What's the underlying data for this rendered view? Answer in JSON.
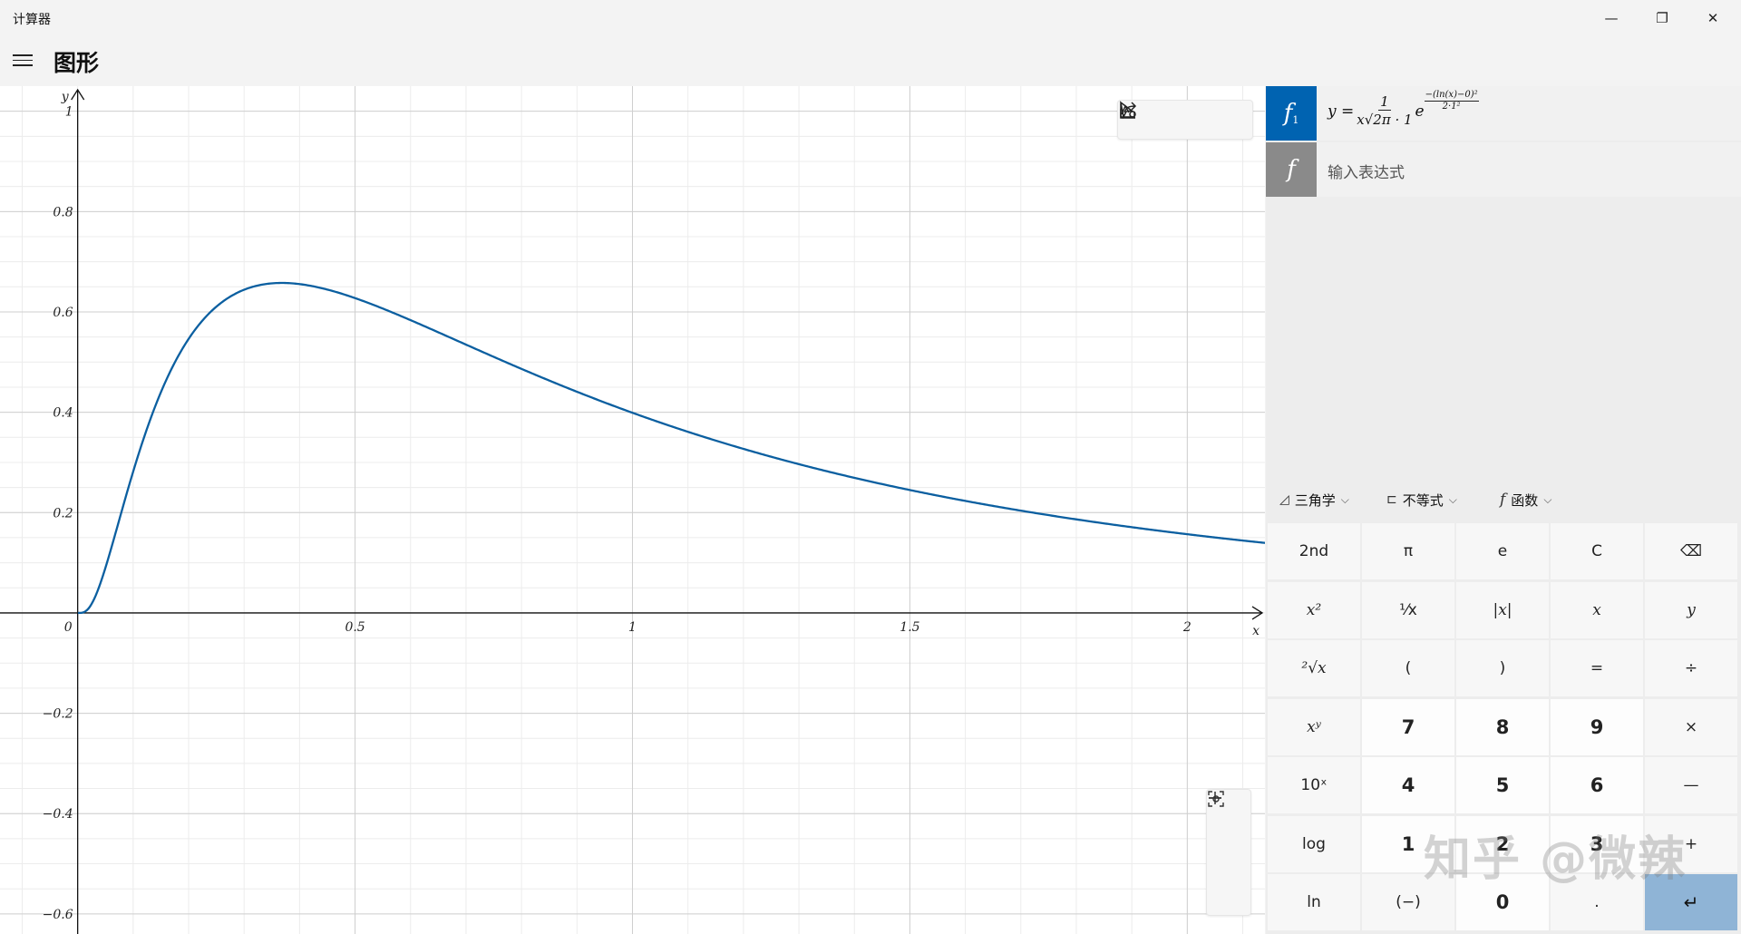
{
  "window": {
    "title": "计算器",
    "controls": {
      "minimize": "—",
      "restore": "❐",
      "close": "✕"
    }
  },
  "header": {
    "mode_title": "图形"
  },
  "graph": {
    "axis_labels": {
      "x": "x",
      "y": "y"
    },
    "x_ticks": [
      "0",
      "0.5",
      "1",
      "1.5",
      "2"
    ],
    "y_ticks": [
      "1",
      "0.8",
      "0.6",
      "0.4",
      "0.2",
      "−0.2",
      "−0.4",
      "−0.6"
    ],
    "toolbar": [
      "select-icon",
      "share-icon",
      "graph-settings-icon"
    ],
    "zoom": {
      "in": "+",
      "out": "—",
      "fit": "fit-icon"
    },
    "curve_color": "#0b5fa0"
  },
  "functions": [
    {
      "badge": "f",
      "subscript": "1",
      "badge_color": "#0063b1",
      "lhs": "y =",
      "fraction_num": "1",
      "fraction_den": "x√2π · 1",
      "base": "e",
      "exp_num": "−(ln(x)−0)²",
      "exp_den": "2·1²"
    },
    {
      "badge": "f",
      "badge_color": "#8a8a8a",
      "placeholder": "输入表达式"
    }
  ],
  "keypad_tabs": [
    {
      "icon": "◿",
      "label": "三角学",
      "chevron": "⌵"
    },
    {
      "icon": "⊏",
      "label": "不等式",
      "chevron": "⌵"
    },
    {
      "icon": "f",
      "label": "函数",
      "chevron": "⌵"
    }
  ],
  "keypad": {
    "row1": [
      "2nd",
      "π",
      "e",
      "C",
      "⌫"
    ],
    "row2": [
      "x²",
      "¹⁄x",
      "|x|",
      "x",
      "y"
    ],
    "row3": [
      "²√x",
      "(",
      ")",
      "=",
      "÷"
    ],
    "row4": [
      "xʸ",
      "7",
      "8",
      "9",
      "×"
    ],
    "row5": [
      "10ˣ",
      "4",
      "5",
      "6",
      "—"
    ],
    "row6": [
      "log",
      "1",
      "2",
      "3",
      "+"
    ],
    "row7": [
      "ln",
      "(−)",
      "0",
      ".",
      "↵"
    ]
  },
  "watermark": "知乎 @微辣",
  "chart_data": {
    "type": "line",
    "series": [
      {
        "x": [
          0.0,
          0.05,
          0.1,
          0.15,
          0.2,
          0.25,
          0.3,
          0.368,
          0.45,
          0.5,
          0.6,
          0.7,
          0.8,
          1.0,
          1.2,
          1.5,
          1.8,
          2.0,
          2.3
        ],
        "y": [
          0.0,
          0.064,
          0.282,
          0.468,
          0.546,
          0.627,
          0.644,
          0.658,
          0.644,
          0.627,
          0.583,
          0.534,
          0.489,
          0.399,
          0.333,
          0.244,
          0.187,
          0.157,
          0.123
        ]
      }
    ],
    "xlim": [
      -0.14,
      2.14
    ],
    "ylim": [
      -0.64,
      1.05
    ],
    "xlabel": "x",
    "ylabel": "y",
    "grid": true
  }
}
